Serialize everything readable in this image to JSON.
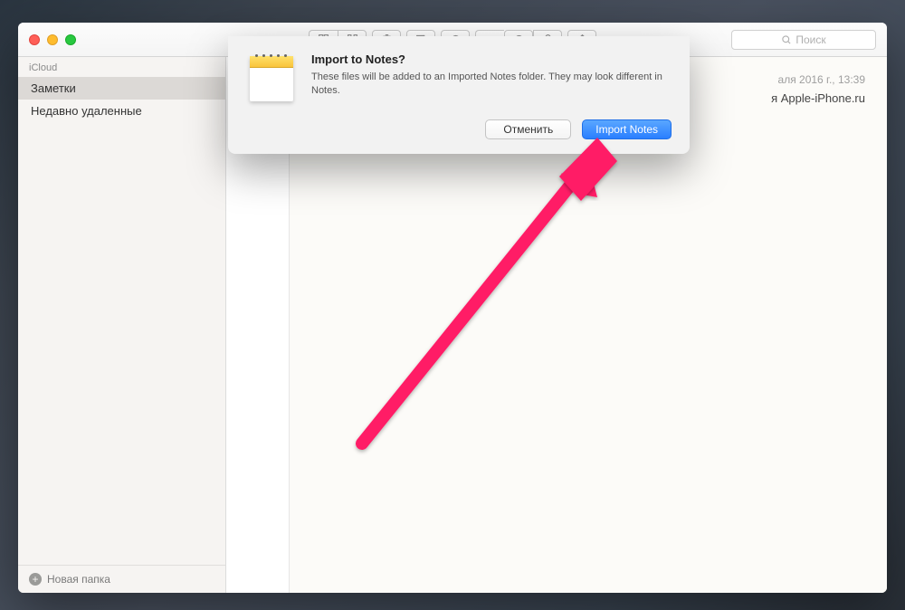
{
  "sidebar": {
    "header": "iCloud",
    "items": [
      "Заметки",
      "Недавно удаленные"
    ],
    "newFolder": "Новая папка"
  },
  "note": {
    "date": "аля 2016 г., 13:39",
    "line": "я Apple-iPhone.ru"
  },
  "search": {
    "placeholder": "Поиск"
  },
  "dialog": {
    "title": "Import to Notes?",
    "message": "These files will be added to an Imported Notes folder. They may look different in Notes.",
    "cancel": "Отменить",
    "confirm": "Import Notes"
  }
}
